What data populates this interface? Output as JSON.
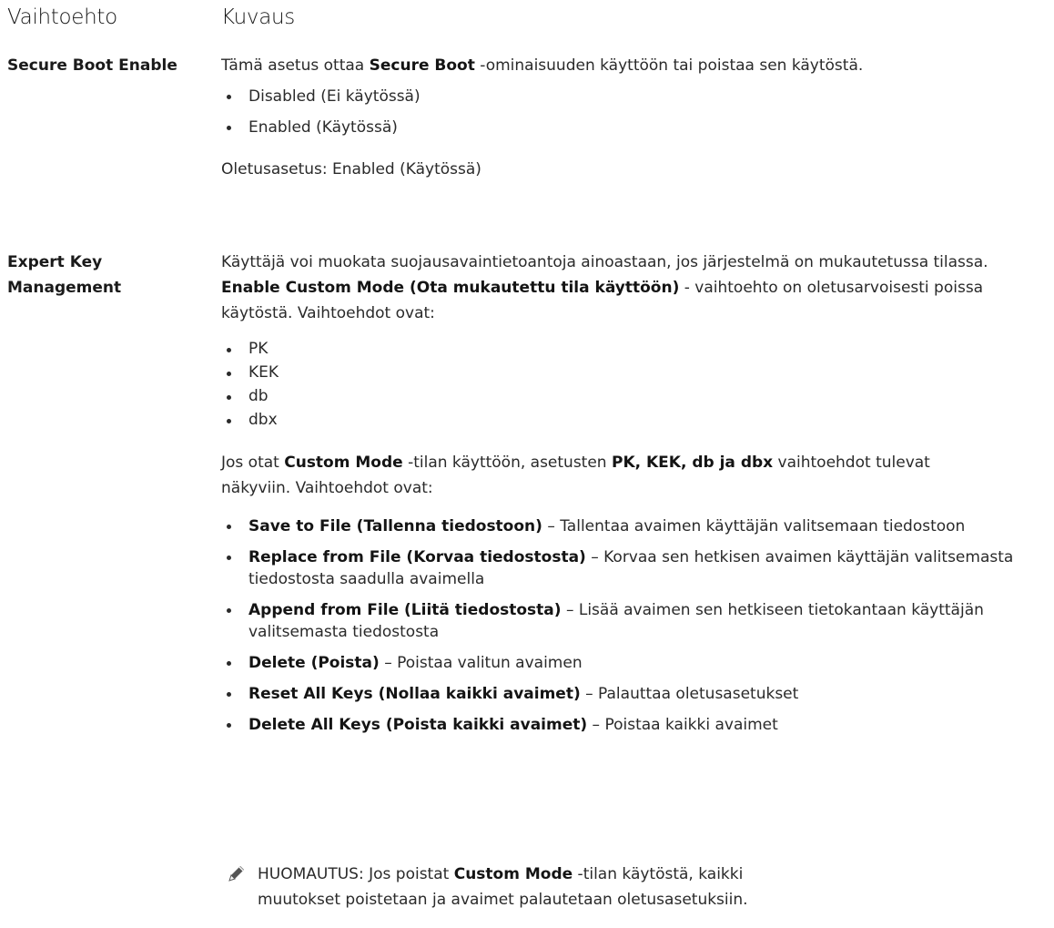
{
  "header": {
    "col_option": "Vaihtoehto",
    "col_description": "Kuvaus"
  },
  "secure_boot": {
    "label": "Secure Boot Enable",
    "intro_before": "Tämä asetus ottaa ",
    "intro_bold": "Secure Boot",
    "intro_after": " -ominaisuuden käyttöön tai poistaa sen käytöstä.",
    "options": [
      "Disabled (Ei käytössä)",
      "Enabled (Käytössä)"
    ],
    "default": "Oletusasetus: Enabled (Käytössä)"
  },
  "expert_key": {
    "label": "Expert Key Management",
    "para1_before": "Käyttäjä voi muokata suojausavaintietoantoja ainoastaan, jos järjestelmä on mukautetussa tilassa. ",
    "para1_bold": "Enable Custom Mode (Ota mukautettu tila käyttöön)",
    "para1_after": " - vaihtoehto on oletusarvoisesti poissa käytöstä. Vaihtoehdot ovat:",
    "keys": [
      "PK",
      "KEK",
      "db",
      "dbx"
    ],
    "para2_before": "Jos otat ",
    "para2_bold1": "Custom Mode",
    "para2_mid": " -tilan käyttöön, asetusten ",
    "para2_bold2": "PK, KEK, db ja dbx",
    "para2_after": " vaihtoehdot tulevat näkyviin. Vaihtoehdot ovat:",
    "actions": [
      {
        "name": "Save to File (Tallenna tiedostoon)",
        "desc": " – Tallentaa avaimen käyttäjän valitsemaan tiedostoon"
      },
      {
        "name": "Replace from File (Korvaa tiedostosta)",
        "desc": " – Korvaa sen hetkisen avaimen käyttäjän valitsemasta tiedostosta saadulla avaimella"
      },
      {
        "name": "Append from File (Liitä tiedostosta)",
        "desc": " – Lisää avaimen sen hetkiseen tietokantaan käyttäjän valitsemasta tiedostosta"
      },
      {
        "name": "Delete (Poista)",
        "desc": " – Poistaa valitun avaimen"
      },
      {
        "name": "Reset All Keys (Nollaa kaikki avaimet)",
        "desc": " – Palauttaa oletusasetukset"
      },
      {
        "name": "Delete All Keys (Poista kaikki avaimet)",
        "desc": " – Poistaa kaikki avaimet"
      }
    ]
  },
  "note": {
    "icon": "pencil-icon",
    "prefix": "HUOMAUTUS:",
    "before": " Jos poistat ",
    "bold": "Custom Mode",
    "after": " -tilan käytöstä, kaikki muutokset poistetaan ja avaimet palautetaan oletusasetuksiin."
  }
}
